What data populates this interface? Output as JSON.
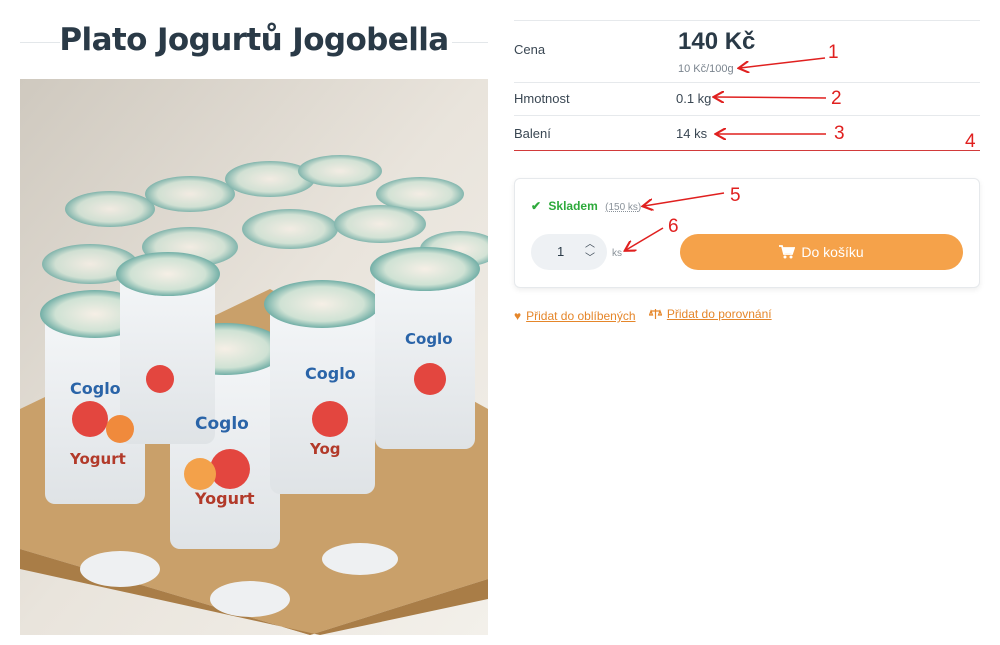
{
  "product": {
    "title": "Plato Jogurtů Jogobella"
  },
  "info": {
    "price_label": "Cena",
    "price": "140 Kč",
    "unit_price": "10 Kč/100g",
    "weight_label": "Hmotnost",
    "weight": "0.1 kg",
    "pack_label": "Balení",
    "pack": "14 ks"
  },
  "cart": {
    "stock_status": "Skladem",
    "stock_count": "(150 ks)",
    "quantity": "1",
    "quantity_unit": "ks",
    "add_label": "Do košíku"
  },
  "links": {
    "favorite": "Přidat do oblíbených",
    "compare": "Přidat do porovnání"
  },
  "annotations": [
    "1",
    "2",
    "3",
    "4",
    "5",
    "6"
  ],
  "colors": {
    "accent": "#f5a24a",
    "link": "#e5862a",
    "stock": "#2eaa3c",
    "annotation": "#e0201f"
  },
  "icons": {
    "check": "check-icon",
    "cart": "cart-icon",
    "favorite": "heart-icon",
    "compare": "scale-icon",
    "qty_up": "chevron-up-icon",
    "qty_down": "chevron-down-icon"
  }
}
